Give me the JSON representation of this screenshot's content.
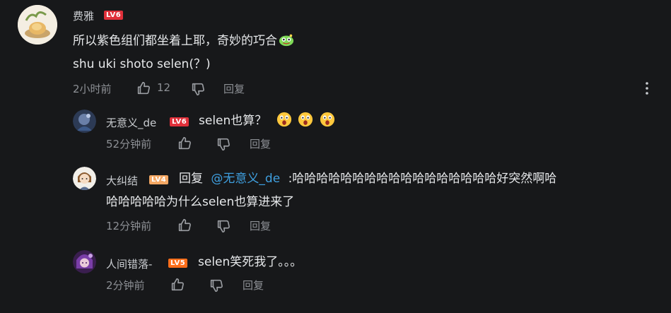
{
  "colors": {
    "background": "#17181a",
    "lv6": "#e0303a",
    "lv5": "#ff6e1a",
    "lv4": "#f5a864",
    "mention": "#3fa0e0",
    "meta": "#8d9095"
  },
  "main_comment": {
    "username": "费雅",
    "level": "LV6",
    "line1": "所以紫色组们都坐着上耶，奇妙的巧合",
    "line2": "shu uki shoto selen(？)",
    "time": "2小时前",
    "likes": "12",
    "reply_label": "回复"
  },
  "replies": [
    {
      "username": "无意义_de",
      "level": "LV6",
      "text": "selen也算？",
      "time": "52分钟前",
      "reply_label": "回复"
    },
    {
      "username": "大纠结",
      "level": "LV4",
      "reply_prefix": "回复",
      "mention": "@无意义_de",
      "text_line1": ":哈哈哈哈哈哈哈哈哈哈哈哈哈哈哈哈哈好突然啊哈",
      "text_line2": "哈哈哈哈哈为什么selen也算进来了",
      "time": "12分钟前",
      "reply_label": "回复"
    },
    {
      "username": "人间错落-",
      "level": "LV5",
      "text": "selen笑死我了。。。",
      "time": "2分钟前",
      "reply_label": "回复"
    }
  ]
}
